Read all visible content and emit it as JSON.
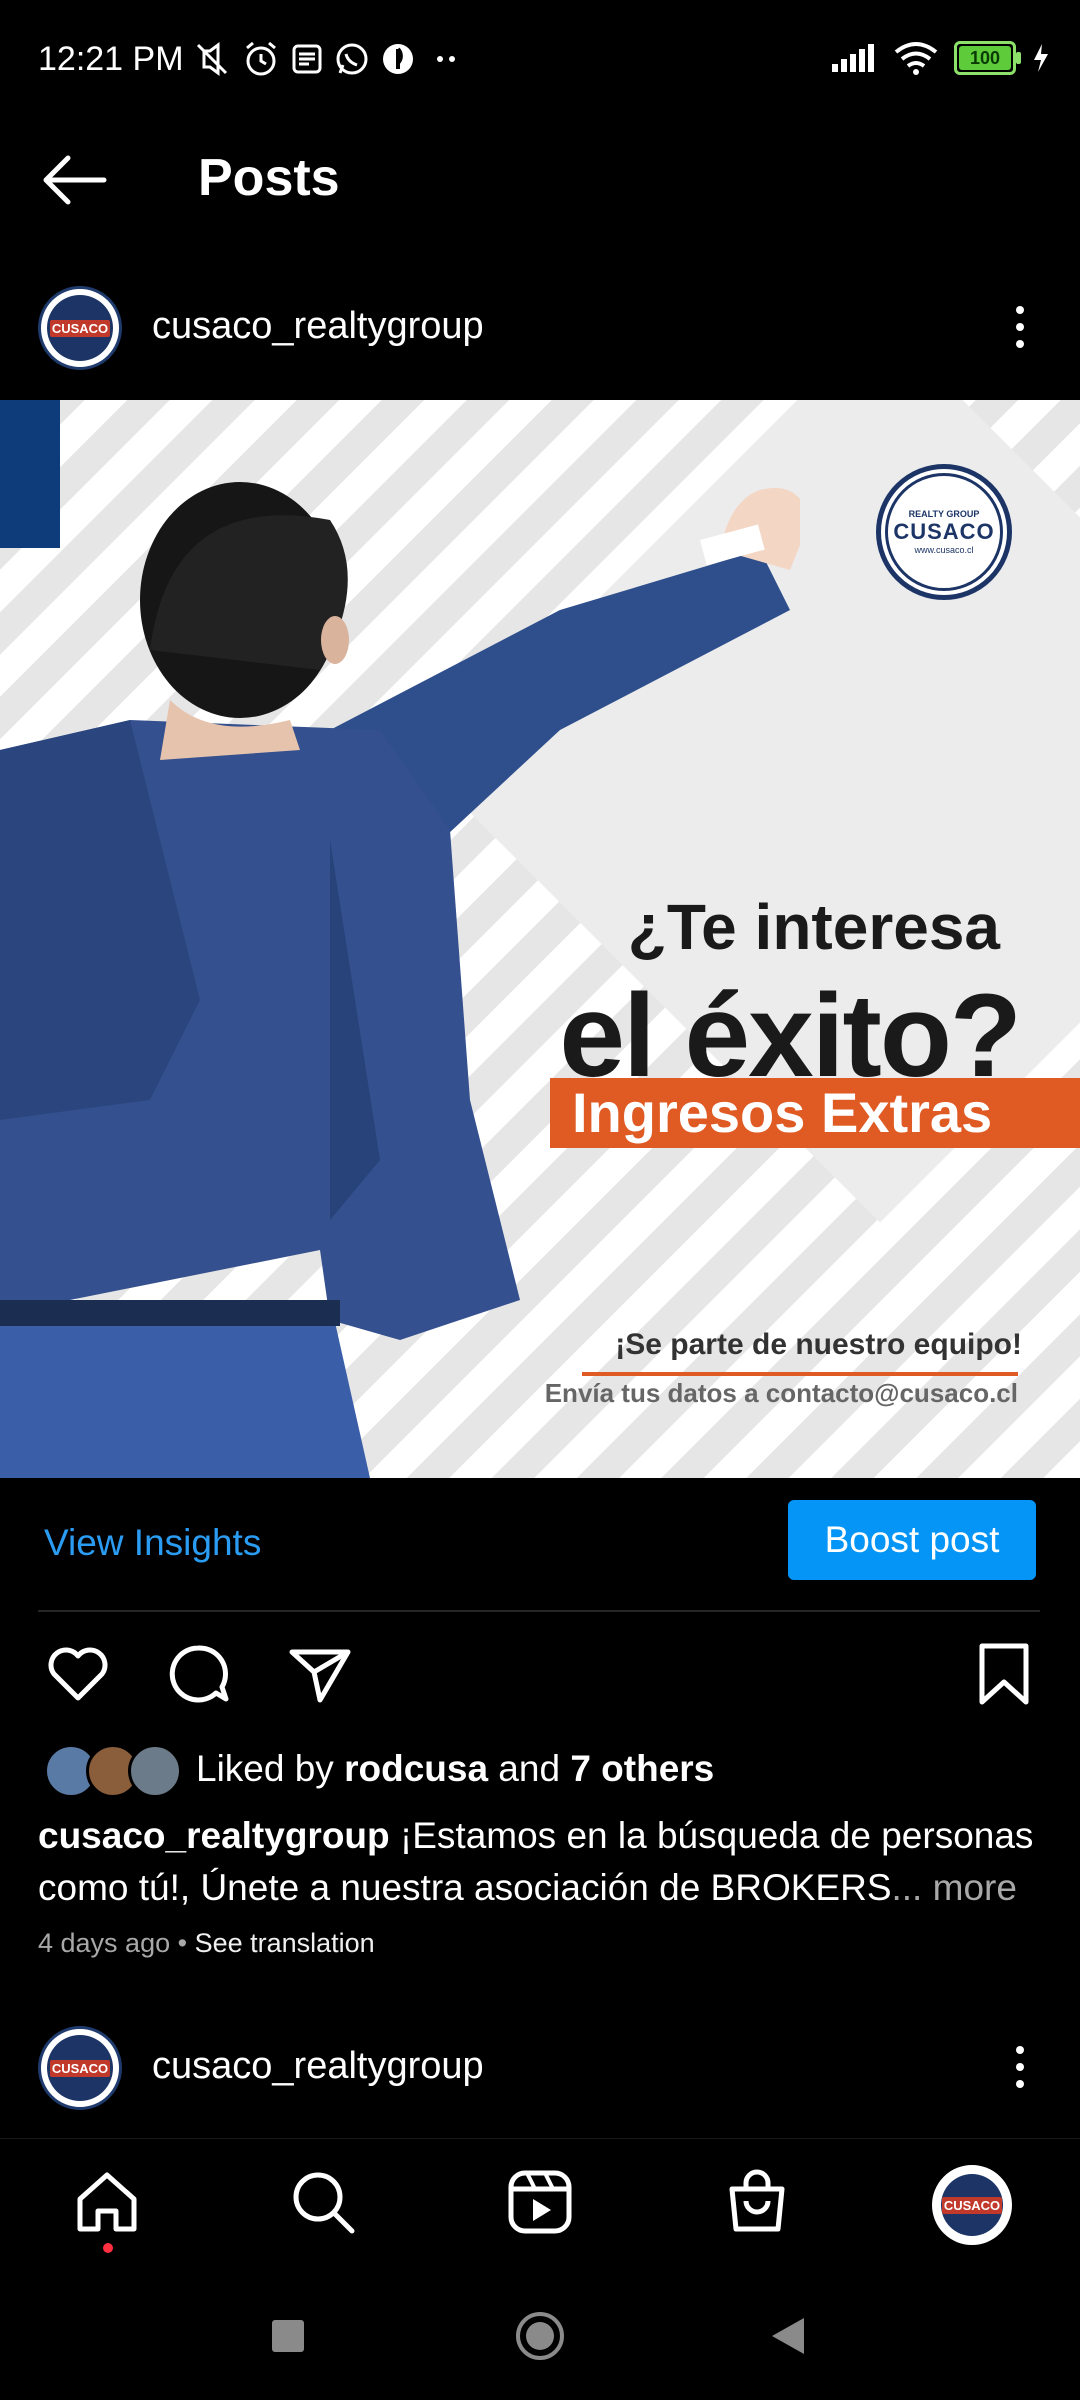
{
  "status_bar": {
    "time": "12:21 PM",
    "battery": "100",
    "icons_left": [
      "mute-icon",
      "alarm-icon",
      "news-icon",
      "whatsapp-icon",
      "app-icon",
      "more-dots-icon"
    ],
    "icons_right": [
      "signal-icon",
      "wifi-icon",
      "battery-icon",
      "charging-icon"
    ]
  },
  "header": {
    "title": "Posts"
  },
  "post": {
    "username": "cusaco_realtygroup",
    "image": {
      "headline_line1": "¿Te interesa",
      "headline_line2": "el éxito?",
      "banner": "Ingresos Extras",
      "cta_line1": "¡Se parte de nuestro equipo!",
      "cta_line2": "Envía tus datos a contacto@cusaco.cl",
      "logo_text": "CUSACO",
      "logo_top": "REALTY GROUP",
      "logo_bottom": "www.cusaco.cl"
    },
    "view_insights": "View Insights",
    "boost_post": "Boost post",
    "liked_prefix": "Liked by ",
    "liked_user": "rodcusa",
    "liked_middle": " and ",
    "liked_others": "7 others",
    "caption_user": "cusaco_realtygroup",
    "caption_text": " ¡Estamos en la búsqueda de personas como tú!, Únete a nuestra asociación de BROKERS",
    "caption_more": "... more",
    "time_ago": "4 days ago",
    "dot": " • ",
    "see_translation": "See translation"
  },
  "next_post": {
    "username": "cusaco_realtygroup"
  },
  "colors": {
    "accent_blue": "#0595f6",
    "link_blue": "#2b9cf3",
    "banner_orange": "#e05a24",
    "brand_navy": "#1c3566"
  }
}
